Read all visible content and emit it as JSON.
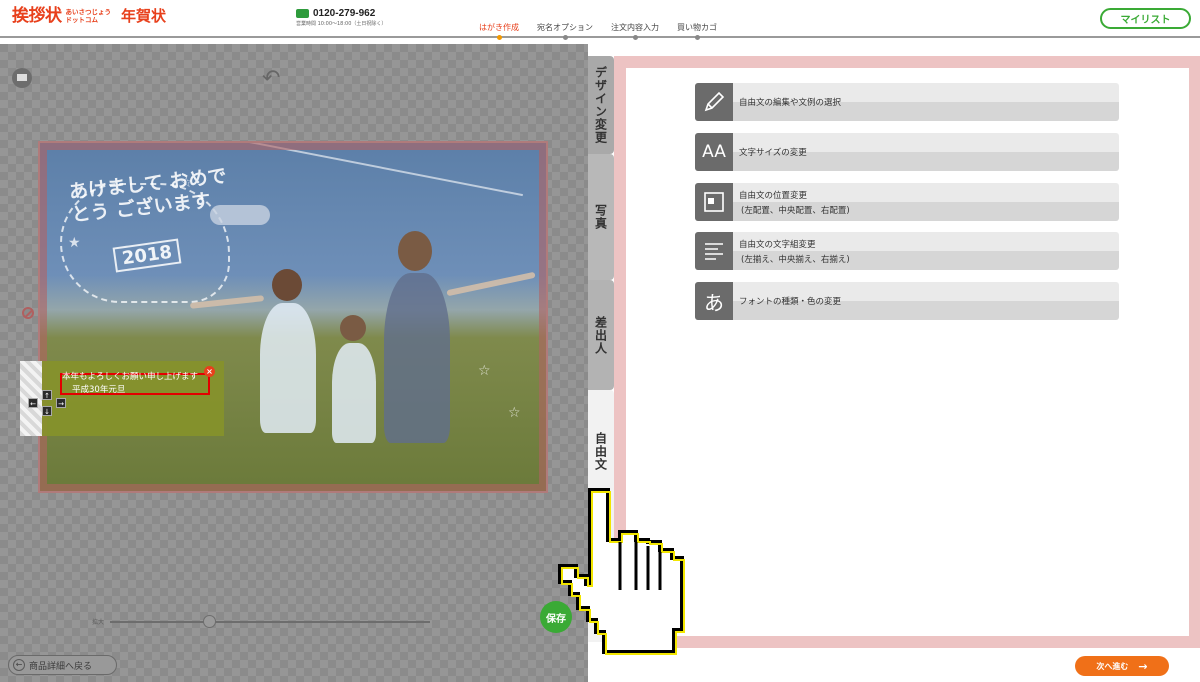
{
  "header": {
    "logo_main": "挨拶状",
    "logo_sub_top": "あいさつじょう",
    "logo_sub_bottom": "ドットコム",
    "logo_product": "年賀状",
    "phone_number": "0120-279-962",
    "phone_hours": "営業時間 10:00～18:00（土日祝除く）",
    "steps": [
      {
        "label": "はがき作成",
        "active": true
      },
      {
        "label": "宛名オプション",
        "active": false
      },
      {
        "label": "注文内容入力",
        "active": false
      },
      {
        "label": "買い物カゴ",
        "active": false
      }
    ],
    "mylist_label": "マイリスト"
  },
  "editor": {
    "card_art": {
      "greeting": "あけまして おめでとう ございます",
      "year": "2018"
    },
    "text_layer": {
      "line1": "本年もよろしくお願い申し上げます",
      "line2": "平成30年元旦",
      "close_glyph": "×"
    },
    "zoom_label": "拡大",
    "save_label": "保存",
    "back_label": "商品詳細へ戻る"
  },
  "tabs": [
    {
      "label": "デザイン変更",
      "active": false
    },
    {
      "label": "写真",
      "active": false
    },
    {
      "label": "差出人",
      "active": false
    },
    {
      "label": "自由文",
      "active": true
    }
  ],
  "panel": {
    "items": [
      {
        "icon": "pencil-icon",
        "label": "自由文の編集や文例の選択",
        "sub": ""
      },
      {
        "icon": "font-size-icon",
        "icon_text": "AA",
        "label": "文字サイズの変更",
        "sub": ""
      },
      {
        "icon": "position-icon",
        "label": "自由文の位置変更",
        "sub": "(左配置、中央配置、右配置)"
      },
      {
        "icon": "align-icon",
        "label": "自由文の文字組変更",
        "sub": "(左揃え、中央揃え、右揃え)"
      },
      {
        "icon": "font-type-icon",
        "icon_text": "あ",
        "label": "フォントの種類・色の変更",
        "sub": ""
      }
    ]
  },
  "footer": {
    "next_label": "次へ進む"
  },
  "colors": {
    "brand_orange": "#e8401c",
    "brand_green": "#3aaa35",
    "next_button": "#f07018",
    "panel_border": "#edc3c3"
  }
}
